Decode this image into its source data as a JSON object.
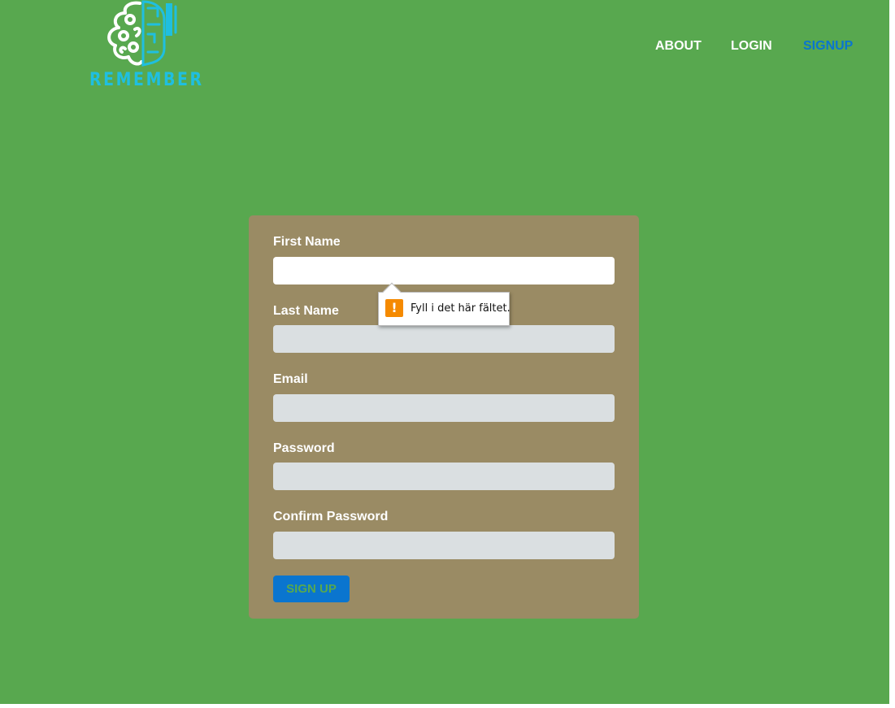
{
  "brand": {
    "logo_text": "REMEMBER",
    "logo_color": "#1fbfe0"
  },
  "nav": {
    "about": "ABOUT",
    "login": "LOGIN",
    "signup": "SIGNUP",
    "active_item": "signup",
    "active_color": "#0a75cf"
  },
  "form": {
    "fields": [
      {
        "label": "First Name",
        "value": "",
        "state": "focused"
      },
      {
        "label": "Last Name",
        "value": ""
      },
      {
        "label": "Email",
        "value": ""
      },
      {
        "label": "Password",
        "value": ""
      },
      {
        "label": "Confirm Password",
        "value": ""
      }
    ],
    "submit_label": "SIGN UP"
  },
  "validation": {
    "message": "Fyll i det här fältet.",
    "icon": "warning-icon",
    "icon_glyph": "!"
  },
  "colors": {
    "page_background": "#58a84f",
    "card_background": "#9a8b64",
    "input_background": "#dadfe1",
    "button_background": "#0a75cf",
    "warning": "#f58a00"
  }
}
